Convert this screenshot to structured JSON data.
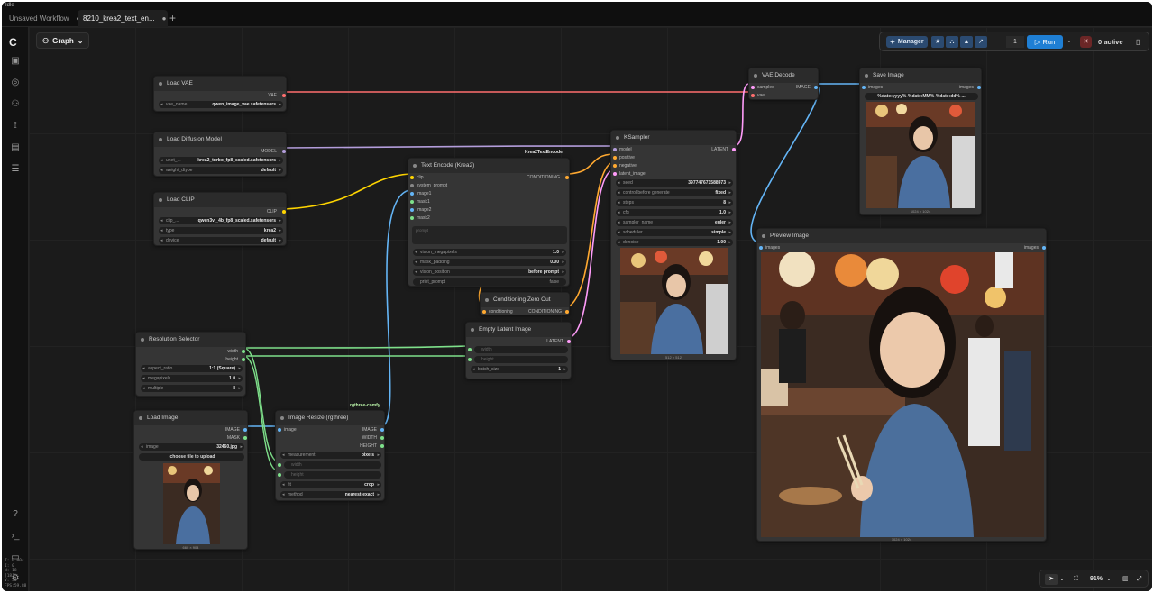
{
  "app": {
    "status": "Idle",
    "tabs": [
      {
        "label": "Unsaved Workflow",
        "modified": "●"
      },
      {
        "label": "8210_krea2_text_en...",
        "modified": "●"
      }
    ],
    "add_tab": "+"
  },
  "canvas_header": {
    "graph_label": "Graph"
  },
  "toolbar": {
    "manager_label": "Manager",
    "queue_count": "1",
    "run_label": "Run",
    "active_label": "0 active"
  },
  "sidebar_icons": [
    "images-icon",
    "models-icon",
    "nodes-icon",
    "workflows-icon",
    "templates-icon",
    "queue-icon"
  ],
  "sidebar_bottom_icons": [
    "help-icon",
    "terminal-icon",
    "console-icon",
    "settings-icon"
  ],
  "stats": [
    "T: 0.00s",
    "I: 0",
    "N: 18 [18]",
    "V: 36",
    "FPS:59.88"
  ],
  "zoom": {
    "value": "91%"
  },
  "nodes": {
    "load_vae": {
      "title": "Load VAE",
      "output": "VAE",
      "widget_label": "vae_name",
      "widget_value": "qwen_image_vae.safetensors"
    },
    "load_diffusion": {
      "title": "Load Diffusion Model",
      "output": "MODEL",
      "w1_label": "unet_...",
      "w1_value": "krea2_turbo_fp8_scaled.safetensors",
      "w2_label": "weight_dtype",
      "w2_value": "default"
    },
    "load_clip": {
      "title": "Load CLIP",
      "output": "CLIP",
      "w1_label": "clip_...",
      "w1_value": "qwen3vl_4b_fp8_scaled.safetensors",
      "w2_label": "type",
      "w2_value": "krea2",
      "w3_label": "device",
      "w3_value": "default"
    },
    "text_encode": {
      "title": "Text Encode (Krea2)",
      "badge": "Krea2TextEncoder",
      "inputs": [
        "clip",
        "system_prompt",
        "image1",
        "mask1",
        "image2",
        "mask2"
      ],
      "output": "CONDITIONING",
      "text_placeholder": "prompt",
      "w1_label": "vision_megapixels",
      "w1_value": "1.0",
      "w2_label": "mask_padding",
      "w2_value": "0.00",
      "w3_label": "vision_position",
      "w3_value": "before prompt",
      "w4_label": "print_prompt",
      "w4_value": "false"
    },
    "conditioning_zero": {
      "title": "Conditioning Zero Out",
      "input": "conditioning",
      "output": "CONDITIONING"
    },
    "ksampler": {
      "title": "KSampler",
      "inputs": [
        "model",
        "positive",
        "negative",
        "latent_image"
      ],
      "output": "LATENT",
      "widgets": [
        {
          "label": "seed",
          "value": "397747671588973"
        },
        {
          "label": "control before generate",
          "value": "fixed"
        },
        {
          "label": "steps",
          "value": "8"
        },
        {
          "label": "cfg",
          "value": "1.0"
        },
        {
          "label": "sampler_name",
          "value": "euler"
        },
        {
          "label": "scheduler",
          "value": "simple"
        },
        {
          "label": "denoise",
          "value": "1.00"
        }
      ],
      "caption": "512 × 512"
    },
    "vae_decode": {
      "title": "VAE Decode",
      "inputs": [
        "samples",
        "vae"
      ],
      "output": "IMAGE"
    },
    "save_image": {
      "title": "Save Image",
      "input": "images",
      "output": "images",
      "prefix": "%date:yyyy%-%date:MM%-%date:dd%-...",
      "caption": "1024 × 1024"
    },
    "preview_image": {
      "title": "Preview Image",
      "input": "images",
      "output": "images",
      "caption": "1024 × 1024"
    },
    "empty_latent": {
      "title": "Empty Latent Image",
      "output": "LATENT",
      "w1_label": "width",
      "w2_label": "height",
      "w3_label": "batch_size",
      "w3_value": "1"
    },
    "resolution_selector": {
      "title": "Resolution Selector",
      "outputs": [
        "width",
        "height"
      ],
      "w1_label": "aspect_ratio",
      "w1_value": "1:1 (Square)",
      "w2_label": "megapixels",
      "w2_value": "1.0",
      "w3_label": "multiple",
      "w3_value": "8"
    },
    "load_image": {
      "title": "Load Image",
      "outputs": [
        "IMAGE",
        "MASK"
      ],
      "w1_label": "image",
      "w1_value": "32460.jpg",
      "upload_label": "choose file to upload",
      "caption": "660 × 904"
    },
    "image_resize": {
      "title": "Image Resize (rgthree)",
      "badge": "rgthree-comfy",
      "input": "image",
      "outputs": [
        "IMAGE",
        "WIDTH",
        "HEIGHT"
      ],
      "w1_label": "measurement",
      "w1_value": "pixels",
      "w2_label": "width",
      "w3_label": "height",
      "w4_label": "fit",
      "w4_value": "crop",
      "w5_label": "method",
      "w5_value": "nearest-exact"
    }
  },
  "colors": {
    "vae": "#ff6e6e",
    "model": "#b39ddb",
    "clip": "#ffd500",
    "conditioning": "#ffa931",
    "latent": "#ff9cf9",
    "image": "#64b5f6",
    "int": "#7ee08a"
  }
}
